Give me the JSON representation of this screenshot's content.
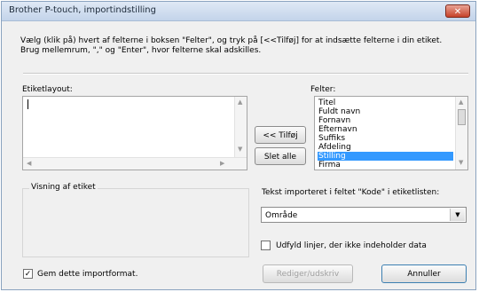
{
  "window": {
    "title": "Brother P-touch, importindstilling",
    "close_icon": "✕"
  },
  "instructions": {
    "line1": "Vælg (klik på) hvert af felterne i boksen \"Felter\", og tryk på [<<Tilføj] for at indsætte felterne i din etiket.",
    "line2": "Brug mellemrum, \",\" og \"Enter\", hvor felterne skal adskilles."
  },
  "layout_label": "Etiketlayout:",
  "layout_value": "",
  "fields_label": "Felter:",
  "fields": [
    {
      "label": "Titel",
      "selected": false
    },
    {
      "label": "Fuldt navn",
      "selected": false
    },
    {
      "label": "Fornavn",
      "selected": false
    },
    {
      "label": "Efternavn",
      "selected": false
    },
    {
      "label": "Suffiks",
      "selected": false
    },
    {
      "label": "Afdeling",
      "selected": false
    },
    {
      "label": "Stilling",
      "selected": true
    },
    {
      "label": "Firma",
      "selected": false
    }
  ],
  "buttons": {
    "add": "<< Tilføj",
    "set_all": "Slet alle",
    "edit_print": "Rediger/udskriv",
    "cancel": "Annuller"
  },
  "preview_group": "Visning af etiket",
  "code_label": "Tekst importeret i feltet \"Kode\" i etiketlisten:",
  "code_select": "Område",
  "fill_lines": {
    "checked": false,
    "label": "Udfyld linjer, der ikke indeholder data"
  },
  "save_format": {
    "checked": true,
    "label": "Gem dette importformat."
  },
  "icons": {
    "check": "✓",
    "down": "▼",
    "up": "▲",
    "left": "◀",
    "right": "▶"
  }
}
